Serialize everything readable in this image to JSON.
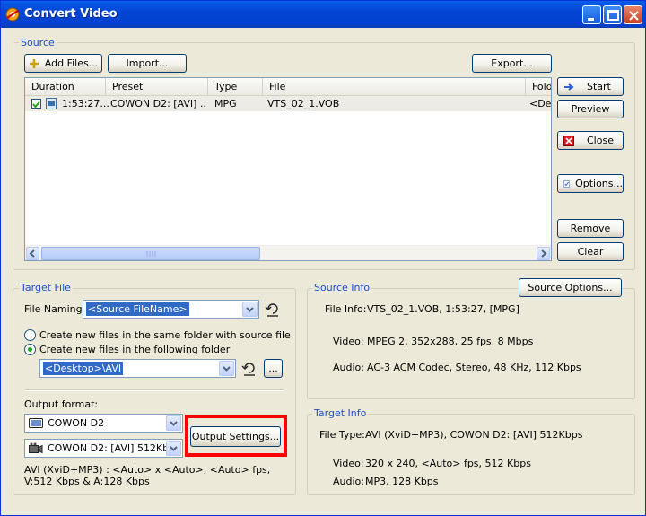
{
  "window": {
    "title": "Convert Video"
  },
  "source": {
    "group_label": "Source",
    "add_files_label": "Add Files...",
    "import_label": "Import...",
    "export_label": "Export...",
    "columns": [
      "Duration",
      "Preset",
      "Type",
      "File",
      "Fold"
    ],
    "rows": [
      {
        "checked": true,
        "duration": "1:53:27...",
        "preset": "COWON D2: [AVI] ...",
        "type": "MPG",
        "file": "VTS_02_1.VOB",
        "folder": "<Des"
      }
    ]
  },
  "side_buttons": {
    "start": "Start",
    "preview": "Preview",
    "close": "Close",
    "options": "Options...",
    "remove": "Remove",
    "clear": "Clear"
  },
  "target_file": {
    "group_label": "Target File",
    "naming_label": "File Naming:",
    "naming_value": "<Source FileName>",
    "radio_same_folder": "Create new files in the same folder with source file",
    "radio_following_folder": "Create new files in the following folder",
    "selected_radio": "following",
    "folder_value": "<Desktop>\\AVI",
    "browse_label": "...",
    "output_format_label": "Output format:",
    "device_value": "COWON D2",
    "profile_value": "COWON D2: [AVI] 512Kb...",
    "output_settings_label": "Output Settings...",
    "format_description": "AVI (XviD+MP3) : <Auto> x <Auto>, <Auto> fps, V:512 Kbps & A:128 Kbps"
  },
  "source_info": {
    "group_label": "Source Info",
    "options_button": "Source Options...",
    "file_info_label": "File Info:",
    "file_info_value": "VTS_02_1.VOB, 1:53:27,  [MPG]",
    "video_label": "Video:",
    "video_value": "MPEG 2, 352x288, 25 fps, 8 Mbps",
    "audio_label": "Audio:",
    "audio_value": "AC-3 ACM Codec, Stereo, 48 KHz, 112 Kbps"
  },
  "target_info": {
    "group_label": "Target Info",
    "file_type_label": "File Type:",
    "file_type_value": "AVI (XviD+MP3), COWON D2: [AVI] 512Kbps",
    "video_label": "Video:",
    "video_value": "320 x 240, <Auto> fps, 512 Kbps",
    "audio_label": "Audio:",
    "audio_value": "MP3, 128 Kbps"
  },
  "colors": {
    "title_bar": "#0445d6",
    "group_label": "#1f4fd0",
    "highlight_box": "#ff0000",
    "selection": "#316ac5"
  }
}
